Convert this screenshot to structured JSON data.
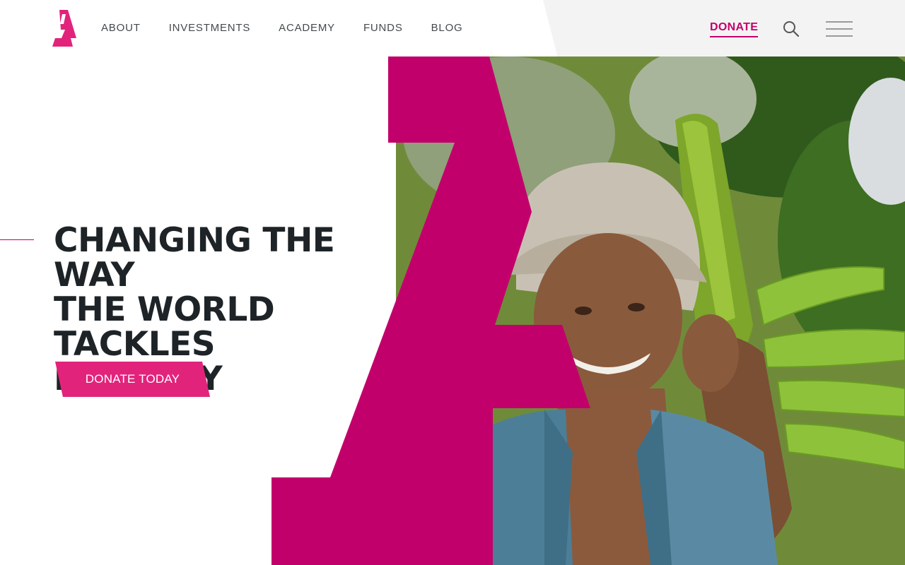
{
  "brand": {
    "logo_icon": "stylized-A-logo",
    "accent_color": "#c2006b",
    "cta_color": "#e2237c"
  },
  "nav": {
    "items": [
      {
        "label": "ABOUT"
      },
      {
        "label": "INVESTMENTS"
      },
      {
        "label": "ACADEMY"
      },
      {
        "label": "FUNDS"
      },
      {
        "label": "BLOG"
      }
    ],
    "donate_label": "DONATE",
    "search_icon": "search-icon",
    "menu_icon": "hamburger-menu-icon"
  },
  "hero": {
    "headline_lines": [
      "CHANGING THE WAY",
      "THE WORLD TACKLES",
      "POVERTY"
    ],
    "cta_label": "DONATE TODAY",
    "image_subject": "farmer-carrying-plantains-photo"
  }
}
